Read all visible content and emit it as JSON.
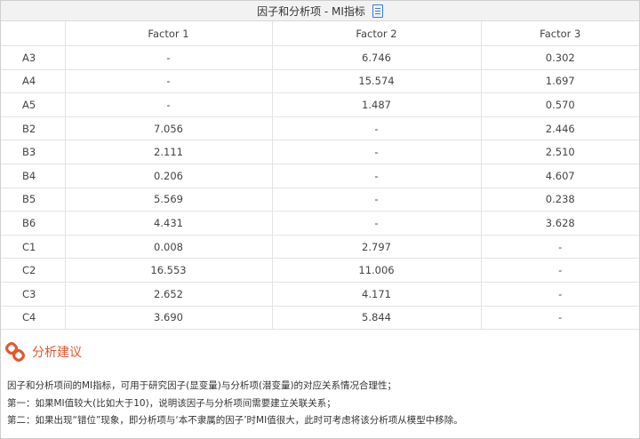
{
  "window": {
    "title": "因子和分析项 - MI指标",
    "title_icon": "document-icon"
  },
  "table": {
    "headers": [
      "",
      "Factor 1",
      "Factor 2",
      "Factor 3"
    ],
    "rows": [
      [
        "A3",
        "-",
        "6.746",
        "0.302"
      ],
      [
        "A4",
        "-",
        "15.574",
        "1.697"
      ],
      [
        "A5",
        "-",
        "1.487",
        "0.570"
      ],
      [
        "B2",
        "7.056",
        "-",
        "2.446"
      ],
      [
        "B3",
        "2.111",
        "-",
        "2.510"
      ],
      [
        "B4",
        "0.206",
        "-",
        "4.607"
      ],
      [
        "B5",
        "5.569",
        "-",
        "0.238"
      ],
      [
        "B6",
        "4.431",
        "-",
        "3.628"
      ],
      [
        "C1",
        "0.008",
        "2.797",
        "-"
      ],
      [
        "C2",
        "16.553",
        "11.006",
        "-"
      ],
      [
        "C3",
        "2.652",
        "4.171",
        "-"
      ],
      [
        "C4",
        "3.690",
        "5.844",
        "-"
      ]
    ]
  },
  "suggestion": {
    "title": "分析建议",
    "icon": "link-icon",
    "accent_color": "#e8552f",
    "lines": [
      "因子和分析项间的MI指标，可用于研究因子(显变量)与分析项(潜变量)的对应关系情况合理性；",
      "第一：如果MI值较大(比如大于10)，说明该因子与分析项间需要建立关联关系；",
      "第二：如果出现“错位”现象，即分析项与‘本不隶属的因子’时MI值很大，此时可考虑将该分析项从模型中移除。"
    ]
  }
}
